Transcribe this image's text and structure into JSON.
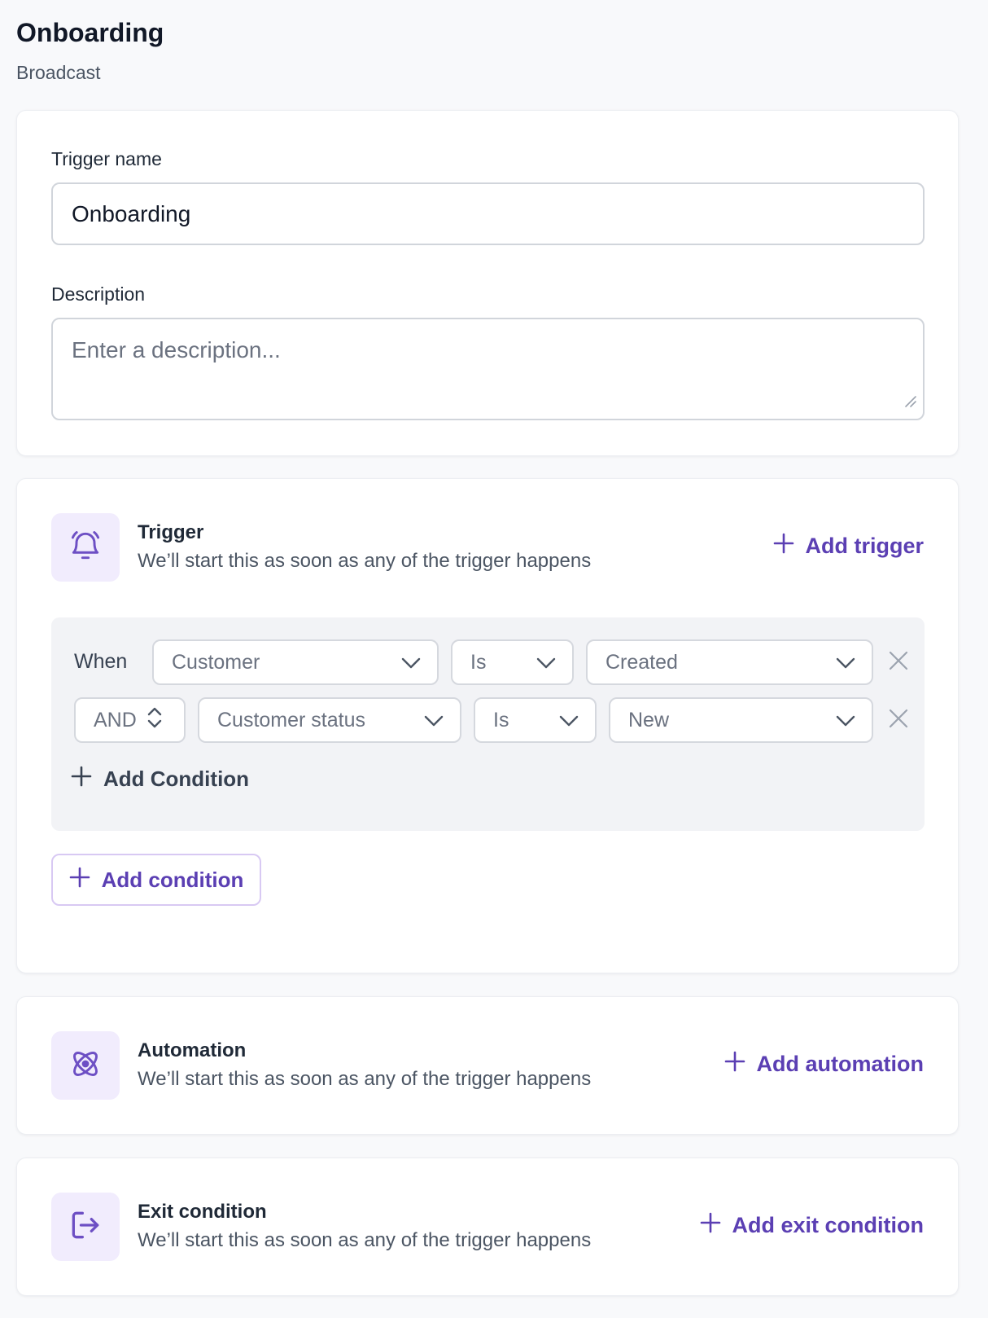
{
  "header": {
    "title": "Onboarding",
    "subtitle": "Broadcast"
  },
  "form": {
    "trigger_name_label": "Trigger name",
    "trigger_name_value": "Onboarding",
    "description_label": "Description",
    "description_placeholder": "Enter a description..."
  },
  "trigger_section": {
    "icon": "bell-icon",
    "title": "Trigger",
    "description": "We’ll start this as soon as any of the trigger happens",
    "add_label": "Add trigger",
    "conditions": {
      "when_label": "When",
      "row1": {
        "entity": "Customer",
        "operator": "Is",
        "value": "Created"
      },
      "row2": {
        "connector": "AND",
        "field": "Customer status",
        "operator": "Is",
        "value": "New"
      },
      "add_inline_label": "Add Condition"
    },
    "add_condition_button": "Add condition"
  },
  "automation_section": {
    "icon": "atom-icon",
    "title": "Automation",
    "description": "We’ll start this as soon as any of the trigger happens",
    "add_label": "Add automation"
  },
  "exit_section": {
    "icon": "exit-icon",
    "title": "Exit condition",
    "description": "We’ll start this as soon as any of the trigger happens",
    "add_label": "Add exit condition"
  },
  "colors": {
    "accent": "#5b3fb3",
    "icon_tile_bg": "#f1ecfd",
    "panel_bg": "#f2f3f6",
    "page_bg": "#f8f9fb"
  }
}
